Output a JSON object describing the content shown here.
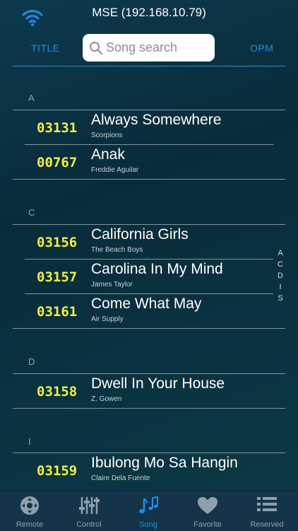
{
  "header": {
    "device_title": "MSE (192.168.10.79)",
    "sort_left": "TITLE",
    "sort_right": "OPM",
    "search_placeholder": "Song search"
  },
  "sections": [
    {
      "letter": "A",
      "songs": [
        {
          "number": "03131",
          "title": "Always Somewhere",
          "artist": "Scorpions"
        },
        {
          "number": "00767",
          "title": "Anak",
          "artist": "Freddie Aguilar"
        }
      ]
    },
    {
      "letter": "C",
      "songs": [
        {
          "number": "03156",
          "title": "California Girls",
          "artist": "The Beach Boys"
        },
        {
          "number": "03157",
          "title": "Carolina In My Mind",
          "artist": "James Taylor"
        },
        {
          "number": "03161",
          "title": "Come What May",
          "artist": "Air Supply"
        }
      ]
    },
    {
      "letter": "D",
      "songs": [
        {
          "number": "03158",
          "title": "Dwell In Your House",
          "artist": "Z. Gowen"
        }
      ]
    },
    {
      "letter": "I",
      "songs": [
        {
          "number": "03159",
          "title": "Ibulong Mo Sa Hangin",
          "artist": "Claire Dela Fuente"
        }
      ]
    }
  ],
  "index_letters": [
    "A",
    "C",
    "D",
    "I",
    "S"
  ],
  "tabs": [
    {
      "label": "Remote",
      "icon": "dpad-icon"
    },
    {
      "label": "Control",
      "icon": "sliders-icon"
    },
    {
      "label": "Song",
      "icon": "music-note-icon",
      "active": true
    },
    {
      "label": "Favorite",
      "icon": "heart-icon"
    },
    {
      "label": "Reserved",
      "icon": "list-icon"
    }
  ],
  "colors": {
    "accent": "#1e8fe6",
    "song_number": "#f2ee4a",
    "tab_inactive": "#8fa0ac"
  }
}
